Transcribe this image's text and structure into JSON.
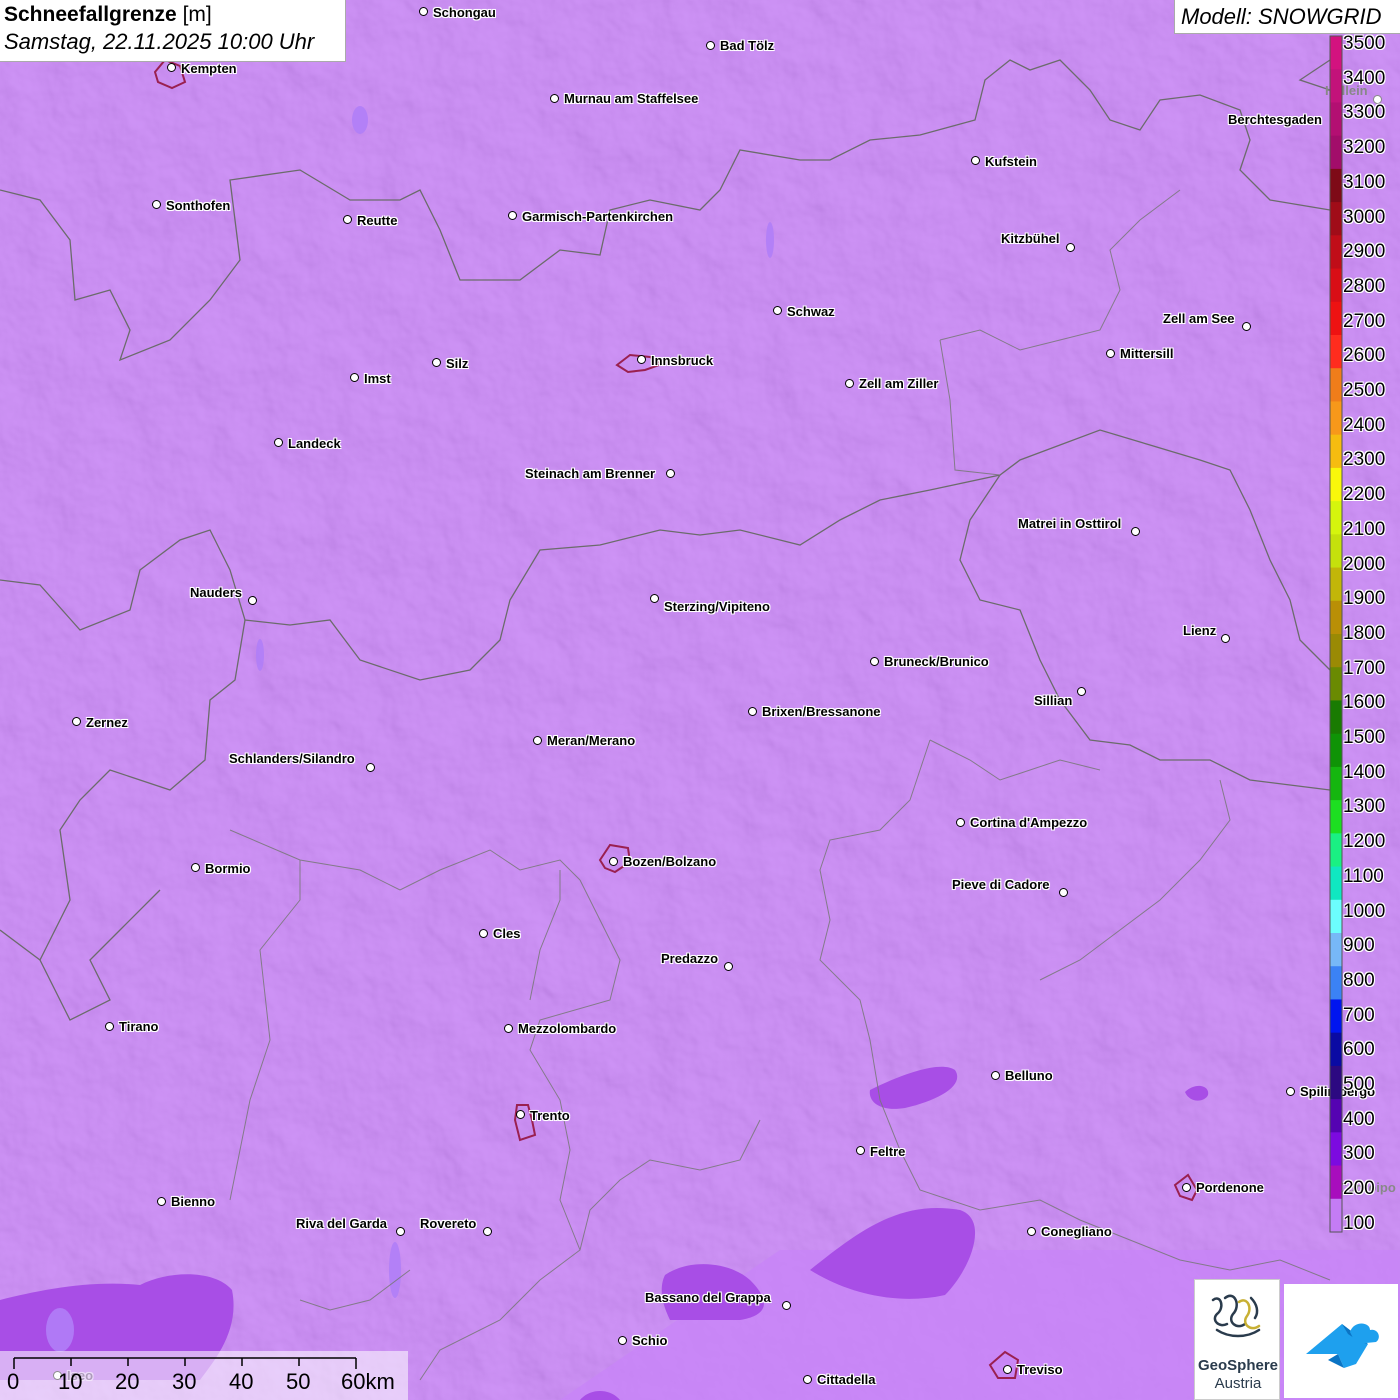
{
  "header": {
    "title_bold": "Schneefallgrenze",
    "title_unit": "[m]",
    "datetime": "Samstag, 22.11.2025 10:00 Uhr"
  },
  "model_label": "Modell: SNOWGRID",
  "legend": {
    "ticks": [
      "3500",
      "3400",
      "3300",
      "3200",
      "3100",
      "3000",
      "2900",
      "2800",
      "2700",
      "2600",
      "2500",
      "2400",
      "2300",
      "2200",
      "2100",
      "2000",
      "1900",
      "1800",
      "1700",
      "1600",
      "1500",
      "1400",
      "1300",
      "1200",
      "1100",
      "1000",
      "900",
      "800",
      "700",
      "600",
      "500",
      "400",
      "300",
      "200",
      "100"
    ],
    "colors": [
      "#d3127f",
      "#c3127a",
      "#b30f72",
      "#a20d6a",
      "#7e0a17",
      "#a00c18",
      "#c00d18",
      "#d90e16",
      "#ee1212",
      "#ff2c1e",
      "#f07d1a",
      "#f7981a",
      "#f6bc10",
      "#f9f70b",
      "#d5f50d",
      "#c5e10c",
      "#c2b609",
      "#b98f06",
      "#9a8a04",
      "#6a8a02",
      "#197b02",
      "#0f9306",
      "#15b60f",
      "#1ddf21",
      "#1af083",
      "#10e7c1",
      "#6cfdfd",
      "#77b8f7",
      "#3b82f5",
      "#0015f0",
      "#0a0aa3",
      "#2c0981",
      "#5503b2",
      "#7c0ae0",
      "#a80dbd",
      "#c47cf5"
    ]
  },
  "cities": [
    {
      "name": "Schongau"
    },
    {
      "name": "Bad Tölz"
    },
    {
      "name": "Kempten"
    },
    {
      "name": "Murnau am Staffelsee"
    },
    {
      "name": "Berchtesgaden"
    },
    {
      "name": "Kufstein"
    },
    {
      "name": "Sonthofen"
    },
    {
      "name": "Reutte"
    },
    {
      "name": "Garmisch-Partenkirchen"
    },
    {
      "name": "Kitzbühel"
    },
    {
      "name": "Schwaz"
    },
    {
      "name": "Zell am See"
    },
    {
      "name": "Innsbruck"
    },
    {
      "name": "Mittersill"
    },
    {
      "name": "Imst"
    },
    {
      "name": "Silz"
    },
    {
      "name": "Zell am Ziller"
    },
    {
      "name": "Landeck"
    },
    {
      "name": "Steinach am Brenner"
    },
    {
      "name": "Matrei in Osttirol"
    },
    {
      "name": "Nauders"
    },
    {
      "name": "Sterzing/Vipiteno"
    },
    {
      "name": "Lienz"
    },
    {
      "name": "Bruneck/Brunico"
    },
    {
      "name": "Sillian"
    },
    {
      "name": "Zernez"
    },
    {
      "name": "Brixen/Bressanone"
    },
    {
      "name": "Meran/Merano"
    },
    {
      "name": "Schlanders/Silandro"
    },
    {
      "name": "Cortina d'Ampezzo"
    },
    {
      "name": "Bormio"
    },
    {
      "name": "Bozen/Bolzano"
    },
    {
      "name": "Pieve di Cadore"
    },
    {
      "name": "Cles"
    },
    {
      "name": "Predazzo"
    },
    {
      "name": "Tirano"
    },
    {
      "name": "Mezzolombardo"
    },
    {
      "name": "Belluno"
    },
    {
      "name": "Spilimbergo"
    },
    {
      "name": "Trento"
    },
    {
      "name": "Feltre"
    },
    {
      "name": "Pordenone"
    },
    {
      "name": "Bienno"
    },
    {
      "name": "Riva del Garda"
    },
    {
      "name": "Rovereto"
    },
    {
      "name": "Conegliano"
    },
    {
      "name": "Bassano del Grappa"
    },
    {
      "name": "Schio"
    },
    {
      "name": "Treviso"
    },
    {
      "name": "Cittadella"
    },
    {
      "name": "Iseo"
    }
  ],
  "partial_labels": {
    "hallein": "Hallein",
    "codroipo": "Codroipo"
  },
  "scalebar": {
    "labels": [
      "0",
      "10",
      "20",
      "30",
      "40",
      "50",
      "60km"
    ]
  },
  "logos": {
    "geosphere_line1": "GeoSphere",
    "geosphere_line2": "Austria"
  },
  "colors": {
    "base_snowline": "#c47cf5",
    "low_snowline": "#a84ee6",
    "border": "#6b6b6b",
    "city_outline": "#9a2050"
  }
}
